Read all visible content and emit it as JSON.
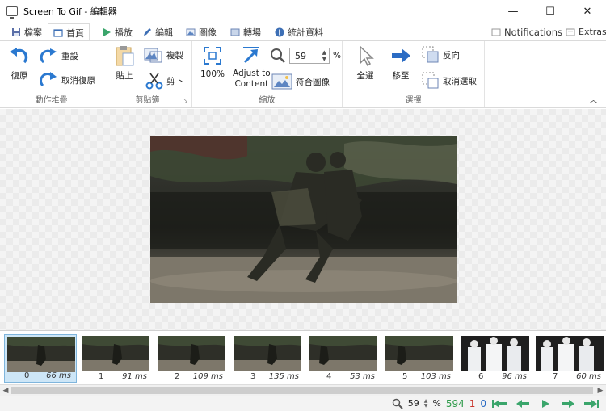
{
  "window": {
    "title": "Screen To Gif - 編輯器",
    "minimize": "—",
    "maximize": "☐",
    "close": "✕"
  },
  "tabs": [
    {
      "label": "檔案"
    },
    {
      "label": "首頁"
    },
    {
      "label": "播放"
    },
    {
      "label": "編輯"
    },
    {
      "label": "圖像"
    },
    {
      "label": "轉場"
    },
    {
      "label": "統計資料"
    }
  ],
  "notifications_label": "Notifications",
  "extras_label": "Extras",
  "ribbon": {
    "undo": "復原",
    "redo": "重設",
    "reset": "取消復原",
    "group_action": "動作堆疊",
    "paste": "貼上",
    "copy": "複製",
    "cut": "剪下",
    "group_clipboard": "剪貼簿",
    "zoom100": "100%",
    "adjust1": "Adjust to",
    "adjust2": "Content",
    "zoom_value": "59",
    "zoom_unit": "%",
    "fit_image": "符合圖像",
    "group_zoom": "縮放",
    "select_all": "全選",
    "go_to": "移至",
    "inverse": "反向",
    "deselect": "取消選取",
    "group_select": "選擇"
  },
  "frames": [
    {
      "num": "0",
      "ms": "66 ms"
    },
    {
      "num": "1",
      "ms": "91 ms"
    },
    {
      "num": "2",
      "ms": "109 ms"
    },
    {
      "num": "3",
      "ms": "135 ms"
    },
    {
      "num": "4",
      "ms": "53 ms"
    },
    {
      "num": "5",
      "ms": "103 ms"
    },
    {
      "num": "6",
      "ms": "96 ms"
    },
    {
      "num": "7",
      "ms": "60 ms"
    }
  ],
  "status": {
    "zoom": "59",
    "zoom_unit": "%",
    "frame_count": "594",
    "selected": "1",
    "current": "0"
  },
  "colors": {
    "accent": "#2b79d0",
    "green": "#2e9b4a",
    "red": "#c8352b",
    "nav_green": "#3aa56b"
  }
}
